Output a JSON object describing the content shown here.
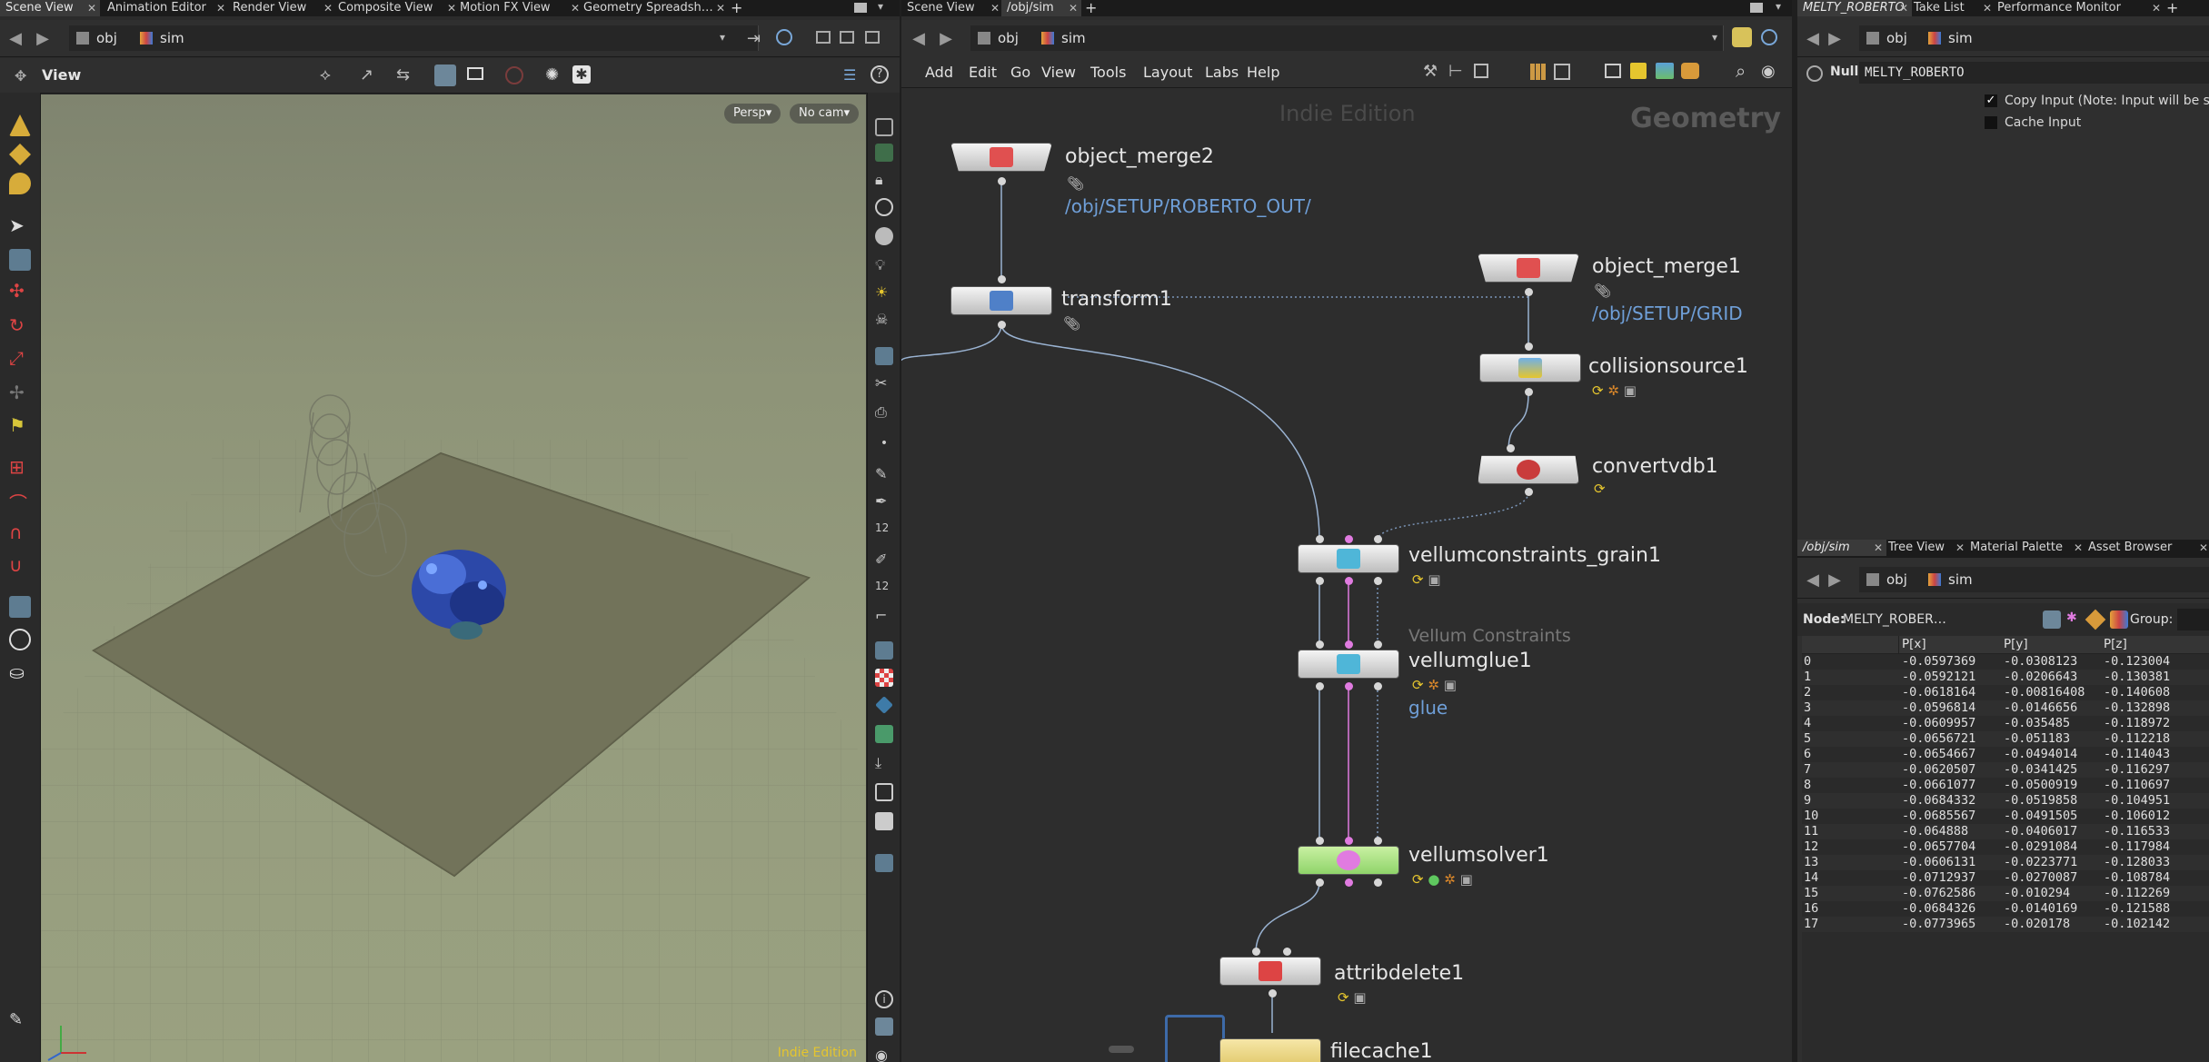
{
  "left_pane": {
    "tabs": [
      {
        "label": "Scene View",
        "active": true
      },
      {
        "label": "Animation Editor",
        "active": false
      },
      {
        "label": "Render View",
        "active": false
      },
      {
        "label": "Composite View",
        "active": false
      },
      {
        "label": "Motion FX View",
        "active": false
      },
      {
        "label": "Geometry Spreadsh…",
        "active": false
      }
    ],
    "add_tab": "+",
    "path": {
      "obj": "obj",
      "node": "sim"
    },
    "view_label": "View",
    "viewport": {
      "persp_button": "Persp▾",
      "cam_button": "No cam▾",
      "edition_watermark": "Indie Edition"
    }
  },
  "mid_pane": {
    "tabs": [
      {
        "label": "Scene View",
        "active": false
      },
      {
        "label": "/obj/sim",
        "active": true
      }
    ],
    "add_tab": "+",
    "path": {
      "obj": "obj",
      "node": "sim"
    },
    "menu": [
      "Add",
      "Edit",
      "Go",
      "View",
      "Tools",
      "Layout",
      "Labs",
      "Help"
    ],
    "watermark": "Indie Edition",
    "context_label": "Geometry",
    "nodes": [
      {
        "id": "object_merge2",
        "name": "object_merge2",
        "sub": "/obj/SETUP/ROBERTO_OUT/"
      },
      {
        "id": "transform1",
        "name": "transform1"
      },
      {
        "id": "object_merge1",
        "name": "object_merge1",
        "sub": "/obj/SETUP/GRID"
      },
      {
        "id": "collisionsource1",
        "name": "collisionsource1"
      },
      {
        "id": "convertvdb1",
        "name": "convertvdb1"
      },
      {
        "id": "vellumconstraints_grain1",
        "name": "vellumconstraints_grain1"
      },
      {
        "id": "vellumglue1",
        "name": "vellumglue1",
        "comment": "Vellum Constraints",
        "sub": "glue"
      },
      {
        "id": "vellumsolver1",
        "name": "vellumsolver1"
      },
      {
        "id": "attribdelete1",
        "name": "attribdelete1"
      },
      {
        "id": "filecache1",
        "name": "filecache1"
      }
    ]
  },
  "right_pane": {
    "top_tabs": [
      {
        "label": "MELTY_ROBERTO",
        "active": true
      },
      {
        "label": "Take List",
        "active": false
      },
      {
        "label": "Performance Monitor",
        "active": false
      }
    ],
    "add_tab": "+",
    "path": {
      "obj": "obj",
      "node": "sim"
    },
    "node_type": "Null",
    "node_name": "MELTY_ROBERTO",
    "params": [
      {
        "label": "Copy Input (Note: Input will be still",
        "checked": true
      },
      {
        "label": "Cache Input",
        "checked": false
      }
    ],
    "bottom_tabs": [
      {
        "label": "/obj/sim",
        "active": true
      },
      {
        "label": "Tree View",
        "active": false
      },
      {
        "label": "Material Palette",
        "active": false
      },
      {
        "label": "Asset Browser",
        "active": false
      }
    ],
    "bottom_path": {
      "obj": "obj",
      "node": "sim"
    },
    "spreadsheet": {
      "node_label": "Node:",
      "node_value": "MELTY_ROBER…",
      "group_label": "Group:",
      "columns": [
        "P[x]",
        "P[y]",
        "P[z]"
      ],
      "rows": [
        [
          "0",
          "-0.0597369",
          "-0.0308123",
          "-0.123004"
        ],
        [
          "1",
          "-0.0592121",
          "-0.0206643",
          "-0.130381"
        ],
        [
          "2",
          "-0.0618164",
          "-0.00816408",
          "-0.140608"
        ],
        [
          "3",
          "-0.0596814",
          "-0.0146656",
          "-0.132898"
        ],
        [
          "4",
          "-0.0609957",
          "-0.035485",
          "-0.118972"
        ],
        [
          "5",
          "-0.0656721",
          "-0.051183",
          "-0.112218"
        ],
        [
          "6",
          "-0.0654667",
          "-0.0494014",
          "-0.114043"
        ],
        [
          "7",
          "-0.0620507",
          "-0.0341425",
          "-0.116297"
        ],
        [
          "8",
          "-0.0661077",
          "-0.0500919",
          "-0.110697"
        ],
        [
          "9",
          "-0.0684332",
          "-0.0519858",
          "-0.104951"
        ],
        [
          "10",
          "-0.0685567",
          "-0.0491505",
          "-0.106012"
        ],
        [
          "11",
          "-0.064888",
          "-0.0406017",
          "-0.116533"
        ],
        [
          "12",
          "-0.0657704",
          "-0.0291084",
          "-0.117984"
        ],
        [
          "13",
          "-0.0606131",
          "-0.0223771",
          "-0.128033"
        ],
        [
          "14",
          "-0.0712937",
          "-0.0270087",
          "-0.108784"
        ],
        [
          "15",
          "-0.0762586",
          "-0.010294",
          "-0.112269"
        ],
        [
          "16",
          "-0.0684326",
          "-0.0140169",
          "-0.121588"
        ],
        [
          "17",
          "-0.0773965",
          "-0.020178",
          "-0.102142"
        ]
      ]
    }
  },
  "colors": {
    "accent_blue": "#6f9fd8",
    "pink_wire": "#e07be0",
    "solver_green": "#9de07a",
    "flag_yellow": "#e8c23a"
  }
}
